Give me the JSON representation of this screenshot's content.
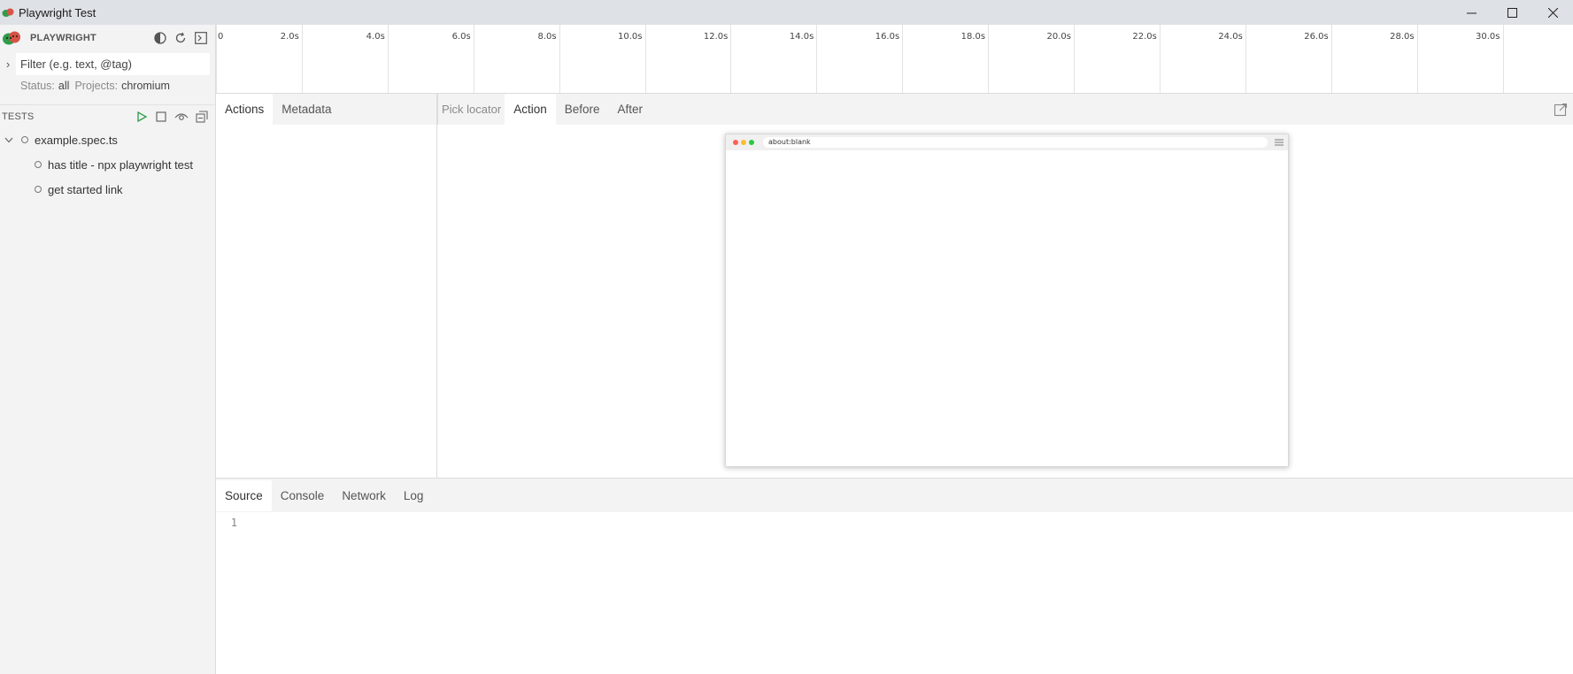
{
  "window": {
    "title": "Playwright Test"
  },
  "sidebar": {
    "brand": "PLAYWRIGHT",
    "filter_placeholder": "Filter (e.g. text, @tag)",
    "status_label": "Status:",
    "status_value": "all",
    "projects_label": "Projects:",
    "projects_value": "chromium",
    "tests_header": "TESTS",
    "tests": [
      {
        "label": "example.spec.ts"
      },
      {
        "label": "has title - npx playwright test"
      },
      {
        "label": "get started link"
      }
    ]
  },
  "timeline": {
    "ticks": [
      "0",
      "2.0s",
      "4.0s",
      "6.0s",
      "8.0s",
      "10.0s",
      "12.0s",
      "14.0s",
      "16.0s",
      "18.0s",
      "20.0s",
      "22.0s",
      "24.0s",
      "26.0s",
      "28.0s",
      "30.0s"
    ]
  },
  "actions_tabs": {
    "actions": "Actions",
    "metadata": "Metadata"
  },
  "snapshot_tabs": {
    "pick_locator": "Pick locator",
    "action": "Action",
    "before": "Before",
    "after": "After"
  },
  "snapshot": {
    "url": "about:blank"
  },
  "bottom_tabs": {
    "source": "Source",
    "console": "Console",
    "network": "Network",
    "log": "Log"
  },
  "source": {
    "line_number": "1"
  },
  "colors": {
    "titlebar": "#dee1e6",
    "sidebar": "#f3f3f3",
    "play_green": "#2e9c4a",
    "dot_red": "#ff5f57",
    "dot_yellow": "#febc2e",
    "dot_green": "#28c840"
  }
}
